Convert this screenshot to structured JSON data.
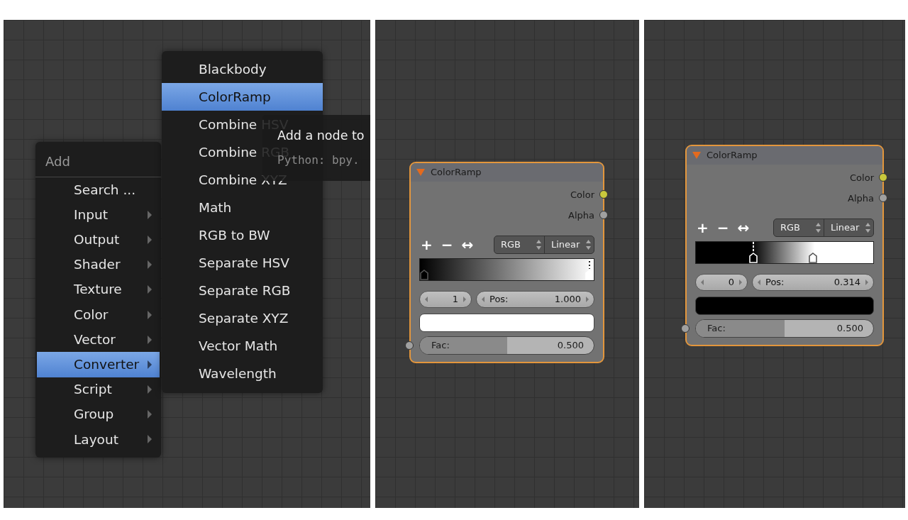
{
  "panels": [
    {
      "kind": "menu",
      "add_menu": {
        "title": "Add",
        "items": [
          {
            "label": "Search ...",
            "has_submenu": false,
            "selected": false
          },
          {
            "label": "Input",
            "has_submenu": true,
            "selected": false
          },
          {
            "label": "Output",
            "has_submenu": true,
            "selected": false
          },
          {
            "label": "Shader",
            "has_submenu": true,
            "selected": false
          },
          {
            "label": "Texture",
            "has_submenu": true,
            "selected": false
          },
          {
            "label": "Color",
            "has_submenu": true,
            "selected": false
          },
          {
            "label": "Vector",
            "has_submenu": true,
            "selected": false
          },
          {
            "label": "Converter",
            "has_submenu": true,
            "selected": true
          },
          {
            "label": "Script",
            "has_submenu": true,
            "selected": false
          },
          {
            "label": "Group",
            "has_submenu": true,
            "selected": false
          },
          {
            "label": "Layout",
            "has_submenu": true,
            "selected": false
          }
        ]
      },
      "submenu": {
        "items": [
          {
            "label": "Blackbody",
            "selected": false
          },
          {
            "label": "ColorRamp",
            "selected": true
          },
          {
            "label": "Combine HSV",
            "selected": false
          },
          {
            "label": "Combine RGB",
            "selected": false
          },
          {
            "label": "Combine XYZ",
            "selected": false
          },
          {
            "label": "Math",
            "selected": false
          },
          {
            "label": "RGB to BW",
            "selected": false
          },
          {
            "label": "Separate HSV",
            "selected": false
          },
          {
            "label": "Separate RGB",
            "selected": false
          },
          {
            "label": "Separate XYZ",
            "selected": false
          },
          {
            "label": "Vector Math",
            "selected": false
          },
          {
            "label": "Wavelength",
            "selected": false
          }
        ]
      },
      "tooltip": {
        "text": "Add a node to",
        "python": "Python: bpy."
      }
    },
    {
      "kind": "node",
      "node": {
        "title": "ColorRamp",
        "outputs": [
          {
            "label": "Color",
            "color": "#c8c83c"
          },
          {
            "label": "Alpha",
            "color": "#a0a0a0"
          }
        ],
        "tools": [
          "+",
          "−",
          "↔"
        ],
        "color_mode": "RGB",
        "interpolation": "Linear",
        "ramp_stops": [
          {
            "level": 0,
            "color": "#000000",
            "selected": false
          },
          {
            "level": 1,
            "color": "#ffffff",
            "selected": true
          }
        ],
        "index": "1",
        "pos_label": "Pos:",
        "pos_value": "1.000",
        "swatch": {
          "color": "#ffffff"
        },
        "input": {
          "label": "Fac:",
          "value": "0.500",
          "level": 0.5,
          "color": "#a0a0a0"
        }
      }
    },
    {
      "kind": "node",
      "node": {
        "title": "ColorRamp",
        "outputs": [
          {
            "label": "Color",
            "color": "#c8c83c"
          },
          {
            "label": "Alpha",
            "color": "#a0a0a0"
          }
        ],
        "tools": [
          "+",
          "−",
          "↔"
        ],
        "color_mode": "RGB",
        "interpolation": "Linear",
        "ramp_stops": [
          {
            "level": 0.314,
            "color": "#000000",
            "selected": true
          },
          {
            "level": 0.67,
            "color": "#ffffff",
            "selected": false
          }
        ],
        "index": "0",
        "pos_label": "Pos:",
        "pos_value": "0.314",
        "swatch": {
          "color": "#000000"
        },
        "input": {
          "label": "Fac:",
          "value": "0.500",
          "level": 0.5,
          "color": "#a0a0a0"
        }
      }
    }
  ]
}
